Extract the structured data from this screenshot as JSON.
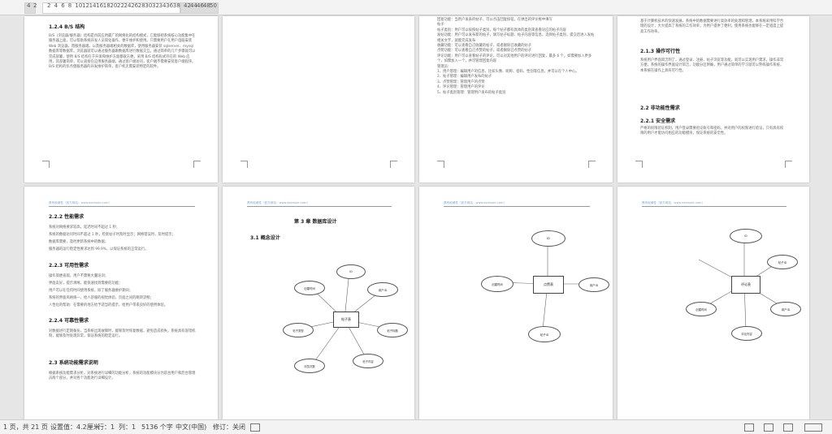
{
  "ruler": {
    "left_numbers": [
      "4",
      "2"
    ],
    "numbers": [
      "2",
      "4",
      "6",
      "8",
      "10",
      "12",
      "14",
      "16",
      "18",
      "20",
      "22",
      "24",
      "26",
      "28",
      "30",
      "32",
      "34",
      "36",
      "38"
    ],
    "right_numbers": [
      "42",
      "44",
      "46",
      "48",
      "50"
    ]
  },
  "pages": {
    "p1": {
      "heading": "1.2.4 B/S 结构",
      "body": "B/S（浏览器/服务器）结构是目前应用最广的网络化的结构模式，它能够把系统核心功能集中在服务器上面，可以帮助系统开发人员简化操作，便于维护和使用。只需要用户在用户电脑安装 Web 浏览器，而服务器端，以及服务器端相关的数据库，使用服务器安装 sqlserver、mysql 数据库等数据库。浏览器就可以通过服务器跟数据库进行数据交互。通过简单的几个步骤就可以完成部署，使用 B/S 结构在于开发和维护方面都很方便。采用 B/S 结构形式存在的 Web 应用，其部署简单，可以直接在应用服务器端，通过客户端访问，客户端不需要安装客户端程序。B/S 结构的优点使服务器的开发维护简单，客户机无需安装特定的软件。"
    },
    "p3": {
      "line1": "回复功能：当用户发表的帖子，可以点击回复按钮，在弹出的评论框中填写",
      "line2": "帖子",
      "line3": "帖子类别：用户可以按照帖子类别，每个帖子都有具体的类别来查看对应的帖子内容",
      "line4": "发帖功能：用户可以发布新的帖子，填写帖子标题、帖子内容等信息，选择帖子类别，提交后进入发帖",
      "line5": "相关文字，就能完成发布",
      "line6": "收藏功能：可以查看自己收藏的帖子，或者删除已收藏的帖子",
      "line7": "点赞功能：可以查看自己点赞的帖子，或者删除已点赞的帖子",
      "line8": "评论功能：用户可以查看帖子的评论，可以对其他用户的评论进行回复，最多 6 个，如需要加入更多",
      "line9": "个，如需加入一个，并可管理回复内容",
      "line10": "管理员：",
      "items": [
        "1、用户管理：编辑用户的信息，比如头像、昵称、密码、性别等信息，并可以在个人中心。",
        "2、帖子管理：编辑用户发布的帖子",
        "3、点赞管理：管理用户的点赞",
        "4、评论管理：管理用户的评论",
        "5、帖子类别管理：管理用户发布的帖子类别"
      ]
    },
    "p4": {
      "intro": "基于计算机技术的快速发展，系统中的数据需要进行高效率的处理和管理，本系统采用科学合理的设计，大大提高了系统的工作效率，为用户提供了便利，使用系统也能够在一定程度上提高工作效率。",
      "h213": "2.1.3 操作可行性",
      "body213": "系统用户界面简洁明了，通过登录、注册、帖子浏览等功能，就可以实现用户需求，操作非常方便。系统的操作界面设计简洁，功能分区明确，用户通过简单的学习就可以熟练操作系统，本系统在操作上具有可行性。",
      "h22": "2.2 非功能性需求",
      "h221": "2.2.1 安全需求",
      "body221": "严格的权限验证机制，用户登录需要验证账号和密码，并对用户的权限进行验证，只有具有权限的用户才能访问相应的功能模块，保证系统的安全性。"
    },
    "p5": {
      "header": "具有权威性（官方网站：www.example.com）",
      "h222": "2.2.2 性能需求",
      "lines222": [
        "系统对网络要求较高，延迟时间不超过 1 秒；",
        "系统的数据访问时间不超过 1 秒，检索帖子时及时显示；网络错误时，及时提示；",
        "数据库需要，及时更新系统中的数据；",
        "服务器的运行稳定性要求达到 99.9%，以保证系统的正常运行。"
      ],
      "h223": "2.2.3 可用性需求",
      "lines223": [
        "操作简便直观，用户不需要大量培训；",
        "界面友好，提示清晰，能快速找到需要的功能；",
        "用户可以在任何时间使用系统，除了服务器维护期间；",
        "系统的界面风格统一，给人舒服的视觉体验，页面之间的跳转流畅；",
        "人性化的帮助：在需要的地方给予适当的提示，给用户带来良好的使用体验。"
      ],
      "h224": "2.2.4 可靠性需求",
      "body224": "对数据进行定期备份，当系统出现故障时，能够及时恢复数据，避免造成损失。系统具有容错机制，能够及时处理异常，保证系统的稳定运行。",
      "h23": "2.3 系统功能需求说明",
      "body23": "根据系统功能需求分析，对系统进行详细的功能分析，系统的功能模块分为前台用户和后台管理员两个部分，并对各个功能进行详细设计。"
    },
    "p6": {
      "header": "具有权威性（官方网站：www.example.com）",
      "chapter": "第 3 章  数据库设计",
      "section": "3.1 概念设计",
      "entity": "帖子表",
      "attrs": [
        "ID",
        "用户ID",
        "帖子标题",
        "帖子内容",
        "浏览次数",
        "帖子类型",
        "创建时间"
      ]
    },
    "p7": {
      "header": "具有权威性（官方网站：www.example.com）",
      "entity": "点赞表",
      "attrs": [
        "ID",
        "用户ID",
        "帖子ID",
        "创建时间"
      ]
    },
    "p8": {
      "header": "具有权威性（官方网站：www.example.com）",
      "entity": "评论表",
      "attrs": [
        "ID",
        "帖子ID",
        "用户ID",
        "评论内容",
        "创建时间"
      ]
    }
  },
  "status": {
    "page": "1 页，共 21 页",
    "position": "设置值：4.2厘米",
    "row": "行：1",
    "col": "列：1",
    "chars": "5136 个字",
    "lang": "中文(中国)",
    "revision": "修订：关闭"
  }
}
